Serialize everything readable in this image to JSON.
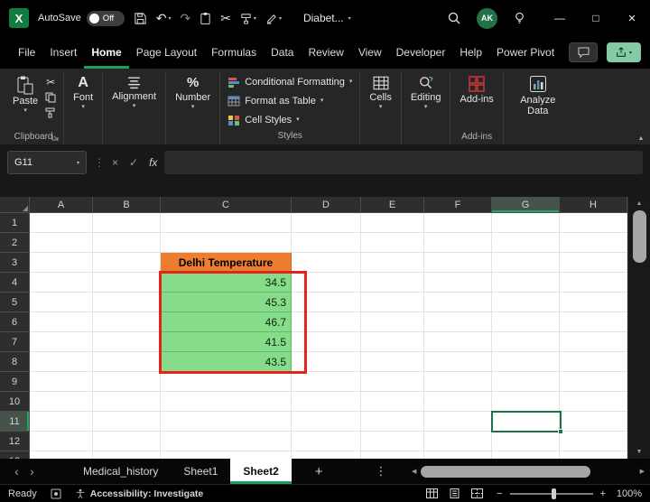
{
  "title_bar": {
    "autosave_label": "AutoSave",
    "autosave_state": "Off",
    "workbook_name": "Diabet...",
    "avatar_initials": "AK"
  },
  "menu_bar": {
    "tabs": [
      "File",
      "Insert",
      "Home",
      "Page Layout",
      "Formulas",
      "Data",
      "Review",
      "View",
      "Developer",
      "Help",
      "Power Pivot"
    ],
    "active_tab": "Home"
  },
  "ribbon": {
    "paste": "Paste",
    "clipboard_group": "Clipboard",
    "font": "Font",
    "alignment": "Alignment",
    "number": "Number",
    "conditional_formatting": "Conditional Formatting",
    "format_as_table": "Format as Table",
    "cell_styles": "Cell Styles",
    "styles_group": "Styles",
    "cells": "Cells",
    "editing": "Editing",
    "addins": "Add-ins",
    "addins_group": "Add-ins",
    "analyze_data": "Analyze Data"
  },
  "formula_bar": {
    "name_box": "G11",
    "cancel": "×",
    "enter": "✓",
    "fx": "fx",
    "formula": ""
  },
  "grid": {
    "columns": [
      "A",
      "B",
      "C",
      "D",
      "E",
      "F",
      "G",
      "H"
    ],
    "row_count": 13,
    "selected": {
      "col": "G",
      "row": 11
    },
    "table": {
      "col": "C",
      "header_row": 3,
      "header_text": "Delhi Temperature",
      "values_start_row": 4,
      "values": [
        "34.5",
        "45.3",
        "46.7",
        "41.5",
        "43.5"
      ]
    }
  },
  "sheet_tabs": {
    "tabs": [
      "Medical_history",
      "Sheet1",
      "Sheet2"
    ],
    "active": "Sheet2"
  },
  "status_bar": {
    "mode": "Ready",
    "accessibility": "Accessibility: Investigate",
    "zoom": "100%"
  },
  "colors": {
    "accent_green": "#107C41",
    "selection_green": "#1fa05a",
    "table_header_orange": "#ED7D31",
    "table_value_green": "#86DC8B",
    "annotation_red": "#e2241a"
  },
  "icons": {
    "excel_logo": "X",
    "undo": "↶",
    "redo": "↷",
    "cut": "✂",
    "chevron_down": "▾",
    "chevron_up": "▴",
    "minimize": "—",
    "maximize": "□",
    "close": "×",
    "nav_left": "‹",
    "nav_right": "›",
    "add": "+",
    "more_vertical": "⋮",
    "scroll_up": "▲",
    "scroll_down": "▼",
    "scroll_left": "◀",
    "scroll_right": "▶",
    "corner_triangle": "◢",
    "font_a": "A",
    "percent": "%",
    "minus": "−",
    "plus": "+",
    "separator_dots": "⋮"
  }
}
